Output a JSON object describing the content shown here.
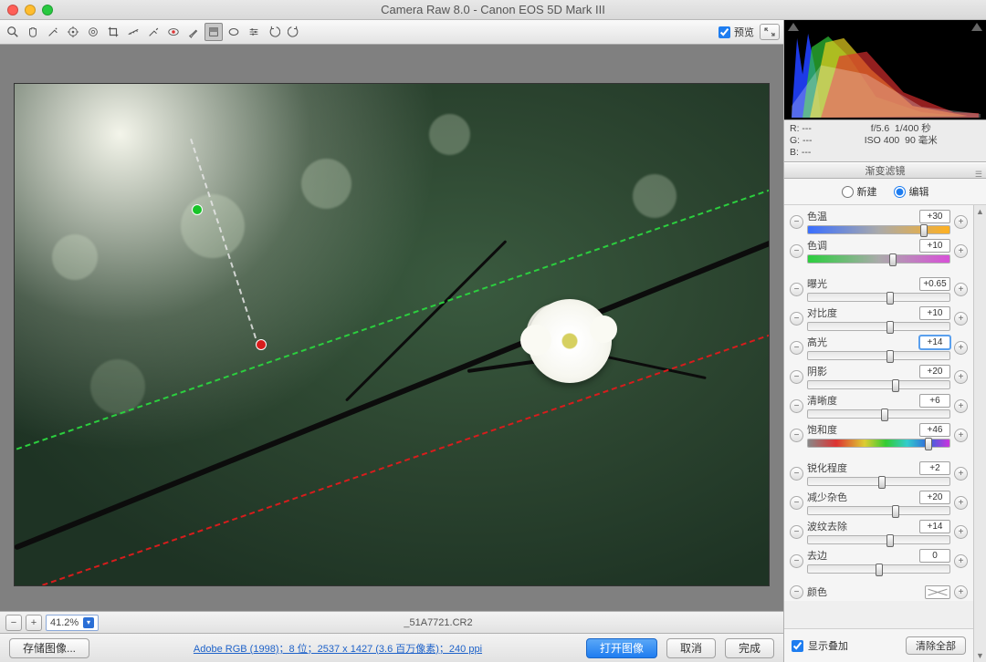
{
  "title": "Camera Raw 8.0 -  Canon EOS 5D Mark III",
  "toolbar": {
    "preview_label": "预览",
    "preview_checked": true
  },
  "zoom": "41.2%",
  "filename": "_51A7721.CR2",
  "footer": {
    "save_image": "存储图像...",
    "profile_link": "Adobe RGB (1998)；8 位；2537 x 1427 (3.6 百万像素)；240 ppi",
    "open_image": "打开图像",
    "cancel": "取消",
    "done": "完成"
  },
  "exif": {
    "r": "R: ---",
    "g": "G: ---",
    "b": "B: ---",
    "aperture": "f/5.6",
    "shutter": "1/400 秒",
    "iso": "ISO 400",
    "focal": "90 毫米"
  },
  "panel": {
    "title": "渐变滤镜",
    "mode_new": "新建",
    "mode_edit": "编辑",
    "sliders": [
      {
        "key": "temperature",
        "label": "色温",
        "value": "+30",
        "pos": 82,
        "track": "temp"
      },
      {
        "key": "tint",
        "label": "色调",
        "value": "+10",
        "pos": 60,
        "track": "tint"
      },
      {
        "gap": true
      },
      {
        "key": "exposure",
        "label": "曝光",
        "value": "+0.65",
        "pos": 58,
        "track": ""
      },
      {
        "key": "contrast",
        "label": "对比度",
        "value": "+10",
        "pos": 58,
        "track": ""
      },
      {
        "key": "highlights",
        "label": "高光",
        "value": "+14",
        "pos": 58,
        "track": "",
        "active": true
      },
      {
        "key": "shadows",
        "label": "阴影",
        "value": "+20",
        "pos": 62,
        "track": ""
      },
      {
        "key": "clarity",
        "label": "清晰度",
        "value": "+6",
        "pos": 54,
        "track": ""
      },
      {
        "key": "saturation",
        "label": "饱和度",
        "value": "+46",
        "pos": 85,
        "track": "sat"
      },
      {
        "gap": true
      },
      {
        "key": "sharpness",
        "label": "锐化程度",
        "value": "+2",
        "pos": 52,
        "track": ""
      },
      {
        "key": "noise",
        "label": "减少杂色",
        "value": "+20",
        "pos": 62,
        "track": ""
      },
      {
        "key": "moire",
        "label": "波纹去除",
        "value": "+14",
        "pos": 58,
        "track": ""
      },
      {
        "key": "defringe",
        "label": "去边",
        "value": "0",
        "pos": 50,
        "track": ""
      }
    ],
    "color_label": "颜色",
    "overlay_label": "显示叠加",
    "clear_all": "清除全部"
  }
}
